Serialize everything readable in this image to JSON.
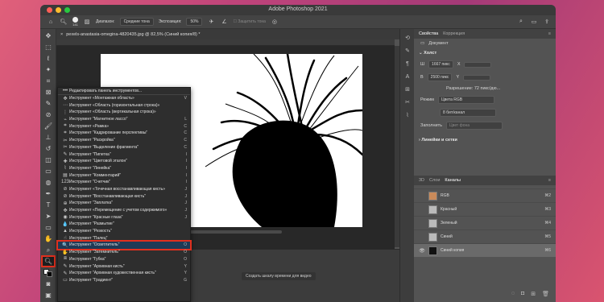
{
  "window": {
    "title": "Adobe Photoshop 2021"
  },
  "options_bar": {
    "brush_size": "141",
    "range_label": "Диапазон:",
    "range_value": "Средние тона",
    "exposure_label": "Экспозиция:",
    "exposure_value": "50%",
    "protect_tones": "Защитить тона"
  },
  "document_tab": {
    "label": "pexels-anastasia-omegina-4820435.jpg @ 82,5% (Синий копия/8) *"
  },
  "timeline": {
    "create_button": "Создать шкалу времени для видео"
  },
  "properties": {
    "tabs": [
      "Свойства",
      "Коррекция"
    ],
    "doc_label": "Документ",
    "canvas_section": "Холст",
    "width_label": "Ш",
    "width_value": "1667 пикс",
    "x_label": "X",
    "height_label": "В",
    "height_value": "2500 пикс",
    "y_label": "Y",
    "resolution": "Разрешение: 72 пикс/дю...",
    "mode_label": "Режим",
    "mode_value": "Цвета RGB",
    "depth_value": "8 бит/канал",
    "fill_label": "Заполнить",
    "fill_value": "Цвет фона",
    "rulers_section": "Линейки и сетки"
  },
  "channels": {
    "tabs": [
      "3D",
      "Слои",
      "Каналы"
    ],
    "items": [
      {
        "name": "RGB",
        "shortcut": "⌘2",
        "visible": false,
        "selected": false
      },
      {
        "name": "Красный",
        "shortcut": "⌘3",
        "visible": false,
        "selected": false
      },
      {
        "name": "Зеленый",
        "shortcut": "⌘4",
        "visible": false,
        "selected": false
      },
      {
        "name": "Синий",
        "shortcut": "⌘5",
        "visible": false,
        "selected": false
      },
      {
        "name": "Синий копия",
        "shortcut": "⌘6",
        "visible": true,
        "selected": true
      }
    ]
  },
  "flyout": {
    "items": [
      {
        "icon": "•••",
        "label": "Редактировать панель инструментов...",
        "key": ""
      },
      {
        "icon": "✥",
        "label": "Инструмент «Монтажная область»",
        "key": "V"
      },
      {
        "icon": "⋯",
        "label": "Инструмент «Область (горизонтальная строка)»",
        "key": ""
      },
      {
        "icon": "⋮",
        "label": "Инструмент «Область (вертикальная строка)»",
        "key": ""
      },
      {
        "icon": "⌁",
        "label": "Инструмент \"Магнитное лассо\"",
        "key": "L"
      },
      {
        "icon": "⌗",
        "label": "Инструмент «Рамка»",
        "key": "C"
      },
      {
        "icon": "⌗",
        "label": "Инструмент \"Кадрирование перспективы\"",
        "key": "C"
      },
      {
        "icon": "✂",
        "label": "Инструмент \"Раскройка\"",
        "key": "C"
      },
      {
        "icon": "✂",
        "label": "Инструмент \"Выделение фрагмента\"",
        "key": "C"
      },
      {
        "icon": "✎",
        "label": "Инструмент \"Пипетка\"",
        "key": "I"
      },
      {
        "icon": "✚",
        "label": "Инструмент \"Цветовой эталон\"",
        "key": "I"
      },
      {
        "icon": "⌇",
        "label": "Инструмент \"Линейка\"",
        "key": "I"
      },
      {
        "icon": "▤",
        "label": "Инструмент \"Комментарий\"",
        "key": "I"
      },
      {
        "icon": "123",
        "label": "Инструмент \"Счетчик\"",
        "key": "I"
      },
      {
        "icon": "⊘",
        "label": "Инструмент «Точечная восстанавливающая кисть»",
        "key": "J"
      },
      {
        "icon": "⊘",
        "label": "Инструмент \"Восстанавливающая кисть\"",
        "key": "J"
      },
      {
        "icon": "⊕",
        "label": "Инструмент \"Заплатка\"",
        "key": "J"
      },
      {
        "icon": "✥",
        "label": "Инструмент «Перемещение с учетом содержимого»",
        "key": "J"
      },
      {
        "icon": "◉",
        "label": "Инструмент \"Красные глаза\"",
        "key": "J"
      },
      {
        "icon": "💧",
        "label": "Инструмент \"Размытие\"",
        "key": ""
      },
      {
        "icon": "▲",
        "label": "Инструмент \"Резкость\"",
        "key": ""
      },
      {
        "icon": "☝",
        "label": "Инструмент \"Палец\"",
        "key": ""
      },
      {
        "icon": "🔍",
        "label": "Инструмент \"Осветлитель\"",
        "key": "O"
      },
      {
        "icon": "✋",
        "label": "Инструмент \"Затемнитель\"",
        "key": "O"
      },
      {
        "icon": "⧈",
        "label": "Инструмент \"Губка\"",
        "key": "O"
      },
      {
        "icon": "✎",
        "label": "Инструмент \"Архивная кисть\"",
        "key": "Y"
      },
      {
        "icon": "✎",
        "label": "Инструмент \"Архивная художественная кисть\"",
        "key": "Y"
      },
      {
        "icon": "▭",
        "label": "Инструмент \"Градиент\"",
        "key": "G"
      }
    ],
    "highlight_index": 22
  },
  "colors": {
    "highlight": "#e0301e",
    "selected_row": "#1f3a56"
  }
}
